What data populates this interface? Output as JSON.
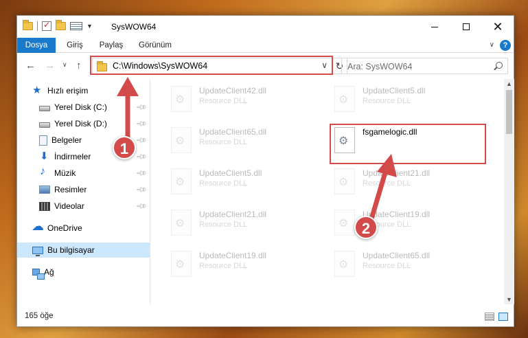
{
  "window": {
    "title": "SysWOW64"
  },
  "ribbon": {
    "tabs": [
      "Dosya",
      "Giriş",
      "Paylaş",
      "Görünüm"
    ],
    "help": "?"
  },
  "address": {
    "path": "C:\\Windows\\SysWOW64"
  },
  "search": {
    "placeholder": "Ara: SysWOW64"
  },
  "sidebar": {
    "items": [
      {
        "label": "Hızlı erişim",
        "icon": "star-icon"
      },
      {
        "label": "Yerel Disk (C:)",
        "icon": "drive-icon"
      },
      {
        "label": "Yerel Disk (D:)",
        "icon": "drive-icon"
      },
      {
        "label": "Belgeler",
        "icon": "document-icon"
      },
      {
        "label": "İndirmeler",
        "icon": "download-icon"
      },
      {
        "label": "Müzik",
        "icon": "music-icon"
      },
      {
        "label": "Resimler",
        "icon": "picture-icon"
      },
      {
        "label": "Videolar",
        "icon": "video-icon"
      },
      {
        "label": "OneDrive",
        "icon": "cloud-icon"
      },
      {
        "label": "Bu bilgisayar",
        "icon": "computer-icon"
      },
      {
        "label": "Ağ",
        "icon": "network-icon"
      }
    ]
  },
  "files": [
    {
      "name": "UpdateClient42.dll",
      "type": "Resource DLL"
    },
    {
      "name": "UpdateClient5.dll",
      "type": "Resource DLL"
    },
    {
      "name": "UpdateClient65.dll",
      "type": "Resource DLL"
    },
    {
      "name": "fsgamelogic.dll",
      "type": ""
    },
    {
      "name": "UpdateClient5.dll",
      "type": "Resource DLL"
    },
    {
      "name": "UpdateClient21.dll",
      "type": "Resource DLL"
    },
    {
      "name": "UpdateClient21.dll",
      "type": "Resource DLL"
    },
    {
      "name": "UpdateClient19.dll",
      "type": "Resource DLL"
    },
    {
      "name": "UpdateClient19.dll",
      "type": "Resource DLL"
    },
    {
      "name": "UpdateClient65.dll",
      "type": "Resource DLL"
    }
  ],
  "status": {
    "count": "165 öğe"
  },
  "annotations": {
    "step1": "1",
    "step2": "2",
    "color": "#d24a4a"
  }
}
